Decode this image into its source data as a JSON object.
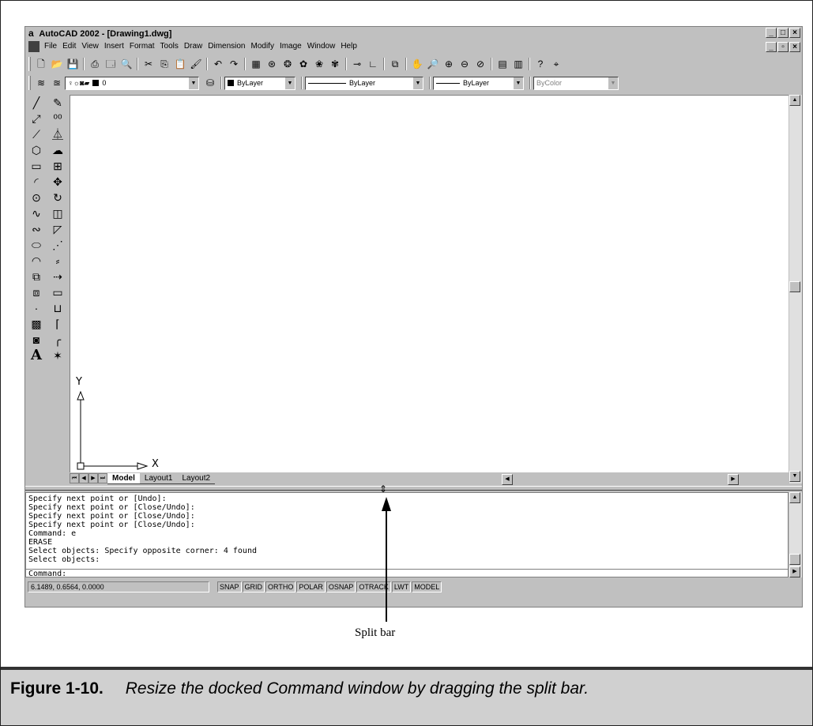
{
  "window": {
    "title": "AutoCAD 2002 - [Drawing1.dwg]",
    "app_icon": "a",
    "controls": [
      "_",
      "□",
      "×"
    ],
    "doc_controls": [
      "_",
      "▫",
      "×"
    ]
  },
  "menu": [
    "File",
    "Edit",
    "View",
    "Insert",
    "Format",
    "Tools",
    "Draw",
    "Dimension",
    "Modify",
    "Image",
    "Window",
    "Help"
  ],
  "properties_bar": {
    "layer": "0",
    "color": "ByLayer",
    "linetype": "ByLayer",
    "lineweight": "ByLayer",
    "plotstyle": "ByColor"
  },
  "ucs": {
    "y_label": "Y",
    "x_label": "X"
  },
  "tabs": {
    "items": [
      "Model",
      "Layout1",
      "Layout2"
    ],
    "active": "Model"
  },
  "command_window": {
    "history": [
      "Specify next point or [Undo]:",
      "Specify next point or [Close/Undo]:",
      "Specify next point or [Close/Undo]:",
      "Specify next point or [Close/Undo]:",
      "Command: e",
      "ERASE",
      "Select objects: Specify opposite corner: 4 found",
      "Select objects:"
    ],
    "prompt": "Command:"
  },
  "status_bar": {
    "coordinates": "6.1489, 0.6564, 0.0000",
    "toggles": [
      "SNAP",
      "GRID",
      "ORTHO",
      "POLAR",
      "OSNAP",
      "OTRACK",
      "LWT",
      "MODEL"
    ]
  },
  "callout": {
    "label": "Split bar"
  },
  "caption": {
    "number": "Figure 1-10.",
    "text": "Resize the docked Command window by dragging the split bar."
  },
  "icons": {
    "standard_toolbar": [
      "new-icon",
      "open-icon",
      "save-icon",
      "print-icon",
      "preview-icon",
      "find-icon",
      "cut-icon",
      "copy-icon",
      "paste-icon",
      "match-properties-icon",
      "undo-icon",
      "redo-icon",
      "today-icon",
      "hyperlink-icon",
      "tracking-icon",
      "snap-from-icon",
      "ucs-icon",
      "distance-icon",
      "aerial-view-icon",
      "pan-icon",
      "zoom-realtime-icon",
      "zoom-window-icon",
      "zoom-previous-icon",
      "properties-icon",
      "design-center-icon",
      "help-icon",
      "snap-icon"
    ],
    "draw_tools": [
      "line-icon",
      "construction-line-icon",
      "polyline-icon",
      "polygon-icon",
      "rectangle-icon",
      "arc-icon",
      "circle-icon",
      "spline-icon",
      "ellipse-icon",
      "ellipse-arc-icon",
      "insert-block-icon",
      "make-block-icon",
      "point-icon",
      "hatch-icon",
      "region-icon",
      "text-icon"
    ],
    "modify_tools": [
      "erase-icon",
      "copy-icon",
      "mirror-icon",
      "offset-icon",
      "array-icon",
      "move-icon",
      "rotate-icon",
      "scale-icon",
      "stretch-icon",
      "lengthen-icon",
      "trim-icon",
      "extend-icon",
      "break-icon",
      "chamfer-icon",
      "fillet-icon",
      "explode-icon"
    ]
  }
}
